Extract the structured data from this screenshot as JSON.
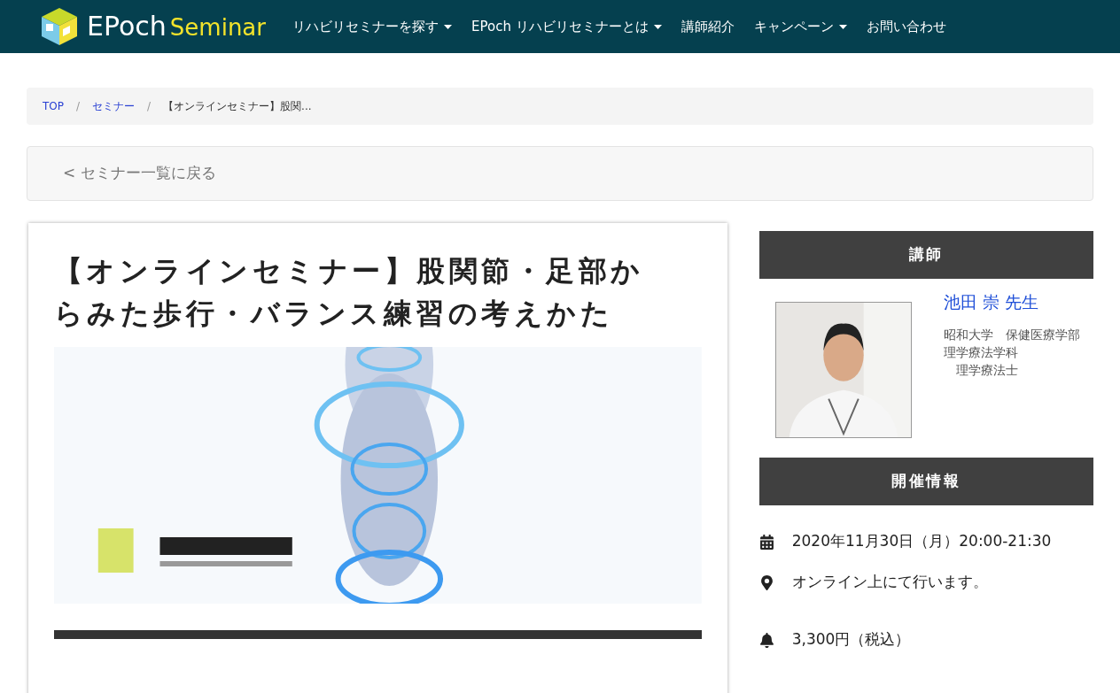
{
  "header": {
    "logo": {
      "word1": "EPoch",
      "word2": "Seminar"
    },
    "nav": [
      {
        "label": "リハビリセミナーを探す",
        "dropdown": true
      },
      {
        "label": "EPoch リハビリセミナーとは",
        "dropdown": true
      },
      {
        "label": "講師紹介",
        "dropdown": false
      },
      {
        "label": "キャンペーン",
        "dropdown": true
      },
      {
        "label": "お問い合わせ",
        "dropdown": false
      }
    ]
  },
  "breadcrumb": [
    {
      "label": "TOP",
      "link": true
    },
    {
      "separator": "/"
    },
    {
      "label": "セミナー",
      "link": true
    },
    {
      "separator": "/"
    },
    {
      "label": "【オンラインセミナー】股関...",
      "link": false
    }
  ],
  "back_link": "< セミナー一覧に戻る",
  "article": {
    "title": "【オンラインセミナー】股関節・足部からみた歩行・バランス練習の考えかた",
    "image": {
      "kind": "picture"
    }
  },
  "sidebar": {
    "instructor": {
      "heading": "講師",
      "photo": {
        "kind": "picture"
      },
      "name": "池田 崇 先生",
      "affiliation": [
        "昭和大学　保健医療学部理学療法学科",
        "　理学療法士"
      ]
    },
    "event": {
      "heading": "開催情報",
      "items": [
        {
          "kind": "date",
          "text": "2020年11月30日（月）20:00-21:30"
        },
        {
          "kind": "place",
          "text": "オンライン上にて行います。"
        },
        {
          "kind": "price",
          "text": "3,300円（税込）"
        }
      ]
    }
  }
}
